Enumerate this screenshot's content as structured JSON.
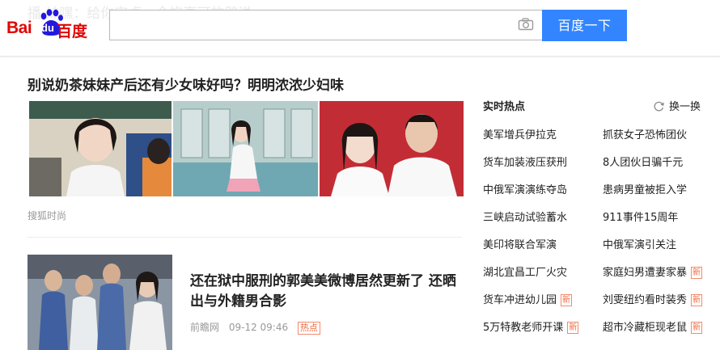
{
  "header": {
    "ghost_text": "播 妹嘿：给你安卓，全饱享可的辟说",
    "logo_text_left": "Bai",
    "logo_text_du": "du",
    "logo_text_right": "百度",
    "search_value": "",
    "search_button": "百度一下"
  },
  "news": {
    "headline": "别说奶茶妹妹产后还有少女味好吗？明明浓浓少妇味",
    "source": "搜狐时尚",
    "article2": {
      "title": "还在狱中服刑的郭美美微博居然更新了 还晒出与外籍男合影",
      "source": "前瞻网",
      "time": "09-12 09:46",
      "tag": "热点"
    }
  },
  "hot": {
    "title": "实时热点",
    "refresh": "换一换",
    "new_label": "新",
    "left": [
      {
        "text": "美军增兵伊拉克",
        "new": false
      },
      {
        "text": "货车加装液压获刑",
        "new": false
      },
      {
        "text": "中俄军演演练夺岛",
        "new": false
      },
      {
        "text": "三峡启动试验蓄水",
        "new": false
      },
      {
        "text": "美印将联合军演",
        "new": false
      },
      {
        "text": "湖北宜昌工厂火灾",
        "new": false
      },
      {
        "text": "货车冲进幼儿园",
        "new": true
      },
      {
        "text": "5万特教老师开课",
        "new": true
      }
    ],
    "right": [
      {
        "text": "抓获女子恐怖团伙",
        "new": false
      },
      {
        "text": "8人团伙日骗千元",
        "new": false
      },
      {
        "text": "患病男童被拒入学",
        "new": false
      },
      {
        "text": "911事件15周年",
        "new": false
      },
      {
        "text": "中俄军演引关注",
        "new": false
      },
      {
        "text": "家庭妇男遭妻家暴",
        "new": true
      },
      {
        "text": "刘雯纽约看时装秀",
        "new": true
      },
      {
        "text": "超市冷藏柜现老鼠",
        "new": true
      }
    ]
  },
  "colors": {
    "brand_red": "#e10602",
    "paw_blue": "#2319dc",
    "button_blue": "#3385ff",
    "tag_orange": "#f06a3f"
  }
}
